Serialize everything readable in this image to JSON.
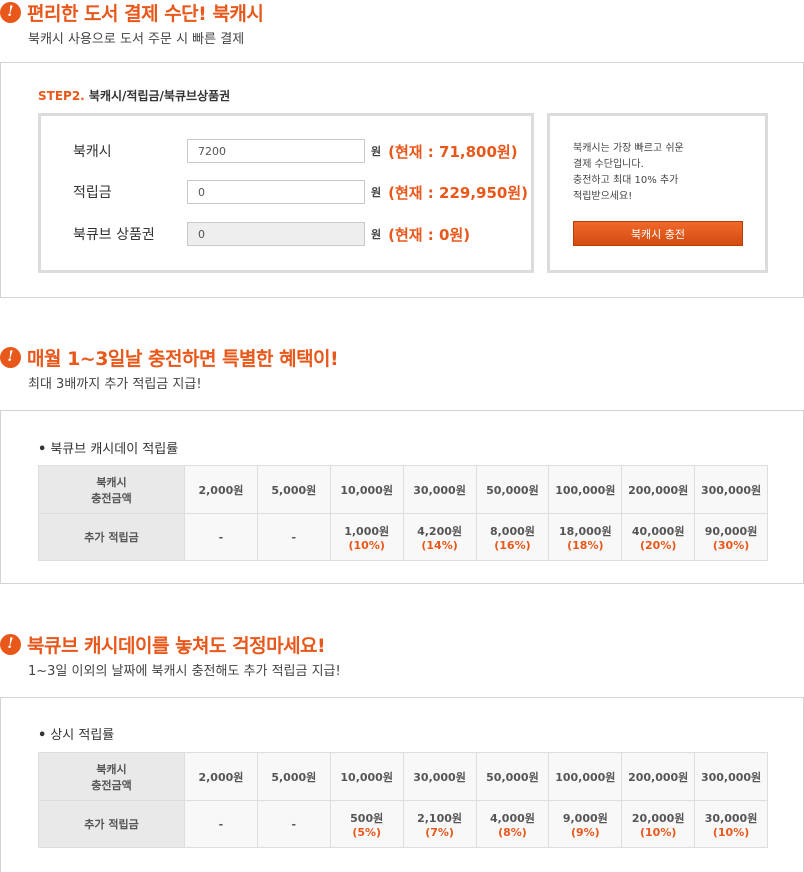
{
  "section1": {
    "title": "편리한 도서 결제 수단! 북캐시",
    "subtitle": "북캐시 사용으로 도서 주문 시 빠른 결제",
    "step_label": "STEP2.",
    "step_title": "북캐시/적립금/북큐브상품권",
    "rows": [
      {
        "label": "북캐시",
        "value": "7200",
        "unit": "원",
        "current": "(현재 : 71,800원)"
      },
      {
        "label": "적립금",
        "value": "0",
        "unit": "원",
        "current": "(현재 : 229,950원)"
      },
      {
        "label": "북큐브 상품권",
        "value": "0",
        "unit": "원",
        "current": "(현재 : 0원)"
      }
    ],
    "desc_lines": [
      "북캐시는 가장 빠르고 쉬운",
      "결제 수단입니다.",
      "충전하고 최대 10% 추가",
      "적립받으세요!"
    ],
    "charge_button": "북캐시 충전"
  },
  "section2": {
    "title": "매월 1~3일날 충전하면 특별한 혜택이!",
    "subtitle": "최대 3배까지 추가 적립금 지급!",
    "table_title": "북큐브 캐시데이 적립률",
    "row1_head": [
      "북캐시",
      "충전금액"
    ],
    "amounts": [
      "2,000원",
      "5,000원",
      "10,000원",
      "30,000원",
      "50,000원",
      "100,000원",
      "200,000원",
      "300,000원"
    ],
    "row2_head": "추가 적립금",
    "bonus": [
      {
        "amt": "-",
        "pct": ""
      },
      {
        "amt": "-",
        "pct": ""
      },
      {
        "amt": "1,000원",
        "pct": "(10%)"
      },
      {
        "amt": "4,200원",
        "pct": "(14%)"
      },
      {
        "amt": "8,000원",
        "pct": "(16%)"
      },
      {
        "amt": "18,000원",
        "pct": "(18%)"
      },
      {
        "amt": "40,000원",
        "pct": "(20%)"
      },
      {
        "amt": "90,000원",
        "pct": "(30%)"
      }
    ]
  },
  "section3": {
    "title": "북큐브 캐시데이를 놓쳐도 걱정마세요!",
    "subtitle": "1~3일 이외의 날짜에 북캐시 충전해도 추가 적립금 지급!",
    "table_title": "상시 적립률",
    "row1_head": [
      "북캐시",
      "충전금액"
    ],
    "amounts": [
      "2,000원",
      "5,000원",
      "10,000원",
      "30,000원",
      "50,000원",
      "100,000원",
      "200,000원",
      "300,000원"
    ],
    "row2_head": "추가 적립금",
    "bonus": [
      {
        "amt": "-",
        "pct": ""
      },
      {
        "amt": "-",
        "pct": ""
      },
      {
        "amt": "500원",
        "pct": "(5%)"
      },
      {
        "amt": "2,100원",
        "pct": "(7%)"
      },
      {
        "amt": "4,000원",
        "pct": "(8%)"
      },
      {
        "amt": "9,000원",
        "pct": "(9%)"
      },
      {
        "amt": "20,000원",
        "pct": "(10%)"
      },
      {
        "amt": "30,000원",
        "pct": "(10%)"
      }
    ]
  }
}
